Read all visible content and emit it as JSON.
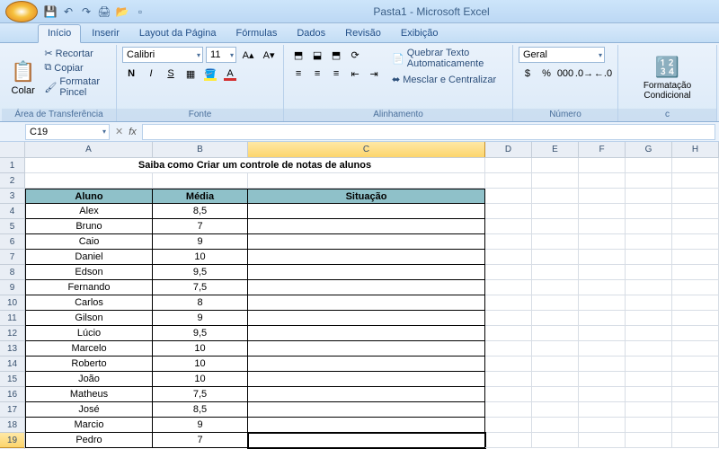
{
  "window_title": "Pasta1 - Microsoft Excel",
  "tabs": {
    "inicio": "Início",
    "inserir": "Inserir",
    "layout": "Layout da Página",
    "formulas": "Fórmulas",
    "dados": "Dados",
    "revisao": "Revisão",
    "exibicao": "Exibição"
  },
  "clipboard": {
    "colar": "Colar",
    "recortar": "Recortar",
    "copiar": "Copiar",
    "pincel": "Formatar Pincel",
    "label": "Área de Transferência"
  },
  "font": {
    "name": "Calibri",
    "size": "11",
    "label": "Fonte"
  },
  "align": {
    "wrap": "Quebrar Texto Automaticamente",
    "merge": "Mesclar e Centralizar",
    "label": "Alinhamento"
  },
  "number": {
    "format": "Geral",
    "label": "Número"
  },
  "styles": {
    "cond": "Formatação Condicional"
  },
  "namebox": "C19",
  "columns": [
    "A",
    "B",
    "C",
    "D",
    "E",
    "F",
    "G",
    "H"
  ],
  "title_row": "Saiba como Criar um controle de notas de alunos",
  "headers": {
    "aluno": "Aluno",
    "media": "Média",
    "situacao": "Situação"
  },
  "rows": [
    {
      "n": "4",
      "aluno": "Alex",
      "media": "8,5"
    },
    {
      "n": "5",
      "aluno": "Bruno",
      "media": "7"
    },
    {
      "n": "6",
      "aluno": "Caio",
      "media": "9"
    },
    {
      "n": "7",
      "aluno": "Daniel",
      "media": "10"
    },
    {
      "n": "8",
      "aluno": "Edson",
      "media": "9,5"
    },
    {
      "n": "9",
      "aluno": "Fernando",
      "media": "7,5"
    },
    {
      "n": "10",
      "aluno": "Carlos",
      "media": "8"
    },
    {
      "n": "11",
      "aluno": "Gilson",
      "media": "9"
    },
    {
      "n": "12",
      "aluno": "Lúcio",
      "media": "9,5"
    },
    {
      "n": "13",
      "aluno": "Marcelo",
      "media": "10"
    },
    {
      "n": "14",
      "aluno": "Roberto",
      "media": "10"
    },
    {
      "n": "15",
      "aluno": "João",
      "media": "10"
    },
    {
      "n": "16",
      "aluno": "Matheus",
      "media": "7,5"
    },
    {
      "n": "17",
      "aluno": "José",
      "media": "8,5"
    },
    {
      "n": "18",
      "aluno": "Marcio",
      "media": "9"
    },
    {
      "n": "19",
      "aluno": "Pedro",
      "media": "7"
    }
  ]
}
